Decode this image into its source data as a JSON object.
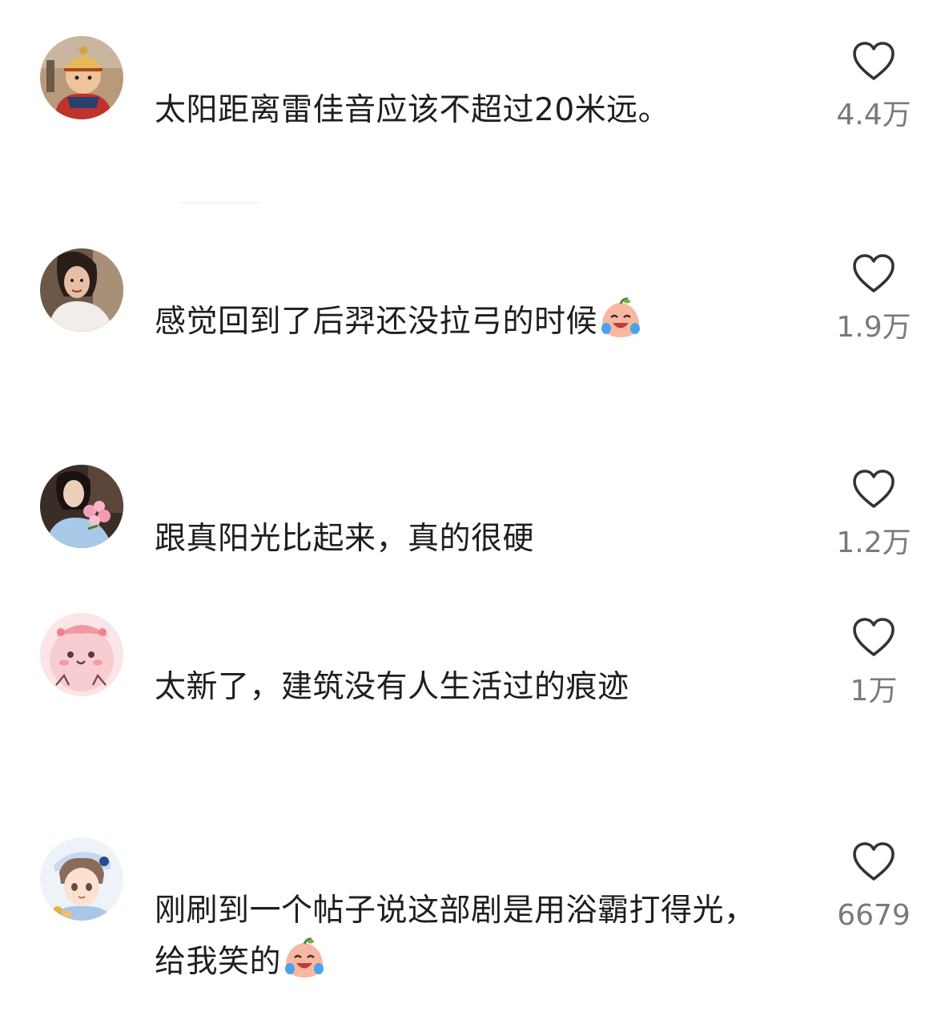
{
  "comments": [
    {
      "text": "太阳距离雷佳音应该不超过20米远。",
      "likes": "4.4万"
    },
    {
      "text": "感觉回到了后羿还没拉弓的时候",
      "likes": "1.9万",
      "emoji": "crying-laughing-peach-emoji"
    },
    {
      "text": "跟真阳光比起来，真的很硬",
      "likes": "1.2万"
    },
    {
      "text": "太新了，建筑没有人生活过的痕迹",
      "likes": "1万"
    },
    {
      "text": "刚刷到一个帖子说这部剧是用浴霸打得光，给我笑的",
      "likes": "6679",
      "emoji": "crying-laughing-peach-emoji"
    }
  ],
  "icons": {
    "like": "heart-outline-icon",
    "avatar": "user-avatar"
  },
  "colors": {
    "text": "#1e1e1e",
    "count": "#7a7a7a",
    "heart_stroke": "#333333"
  }
}
